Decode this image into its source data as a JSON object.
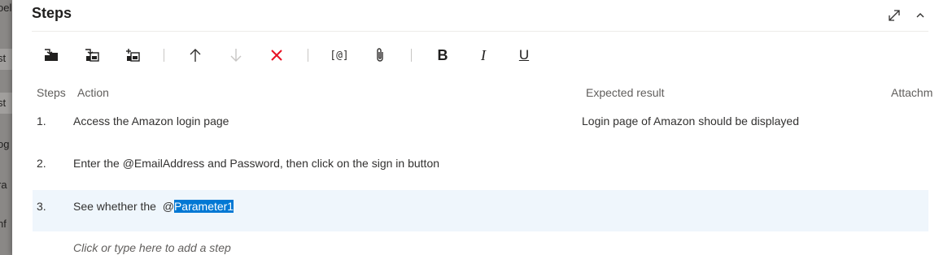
{
  "left_page": {
    "fragments": [
      "oel",
      "st",
      "st",
      "og",
      "ra",
      "nf"
    ]
  },
  "section": {
    "title": "Steps"
  },
  "toolbar": {
    "parameter_label": "[@]",
    "bold_label": "B",
    "italic_label": "I",
    "underline_label": "U"
  },
  "columns": {
    "steps": "Steps",
    "action": "Action",
    "expected": "Expected result",
    "attachments": "Attachm"
  },
  "rows": [
    {
      "num": "1.",
      "action": "Access the Amazon login page",
      "expected": "Login page of Amazon should be displayed"
    },
    {
      "num": "2.",
      "action": "Enter the @EmailAddress and Password, then click on the sign in button",
      "expected": ""
    },
    {
      "num": "3.",
      "action_prefix": "See whether the  @",
      "action_highlight": "Parameter1",
      "expected": ""
    }
  ],
  "add_step_placeholder": "Click or type here to add a step",
  "colors": {
    "selected_row": "#eff6fc",
    "text_highlight": "#0078d4",
    "delete_red": "#e81123"
  }
}
